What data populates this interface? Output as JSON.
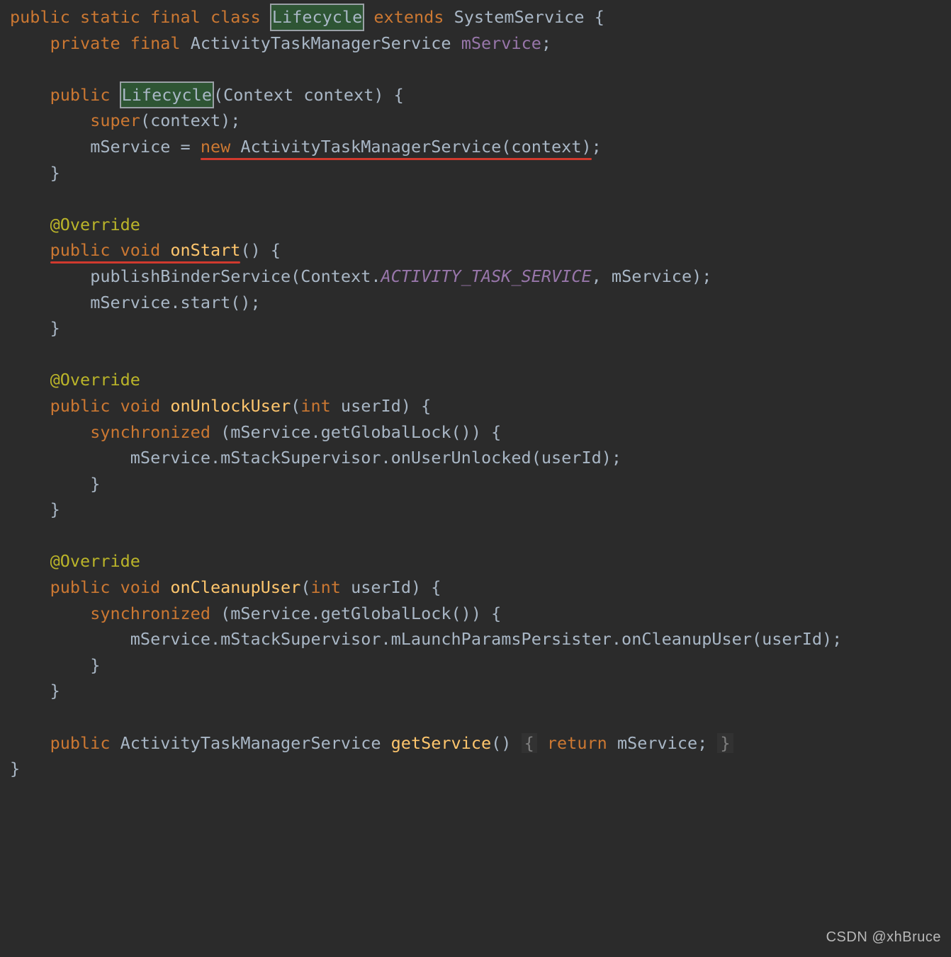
{
  "code": {
    "l1": {
      "kw_public": "public",
      "kw_static": "static",
      "kw_final": "final",
      "kw_class": "class",
      "name": "Lifecycle",
      "kw_extends": "extends",
      "super": "SystemService",
      "brace": "{"
    },
    "l2": {
      "kw_private": "private",
      "kw_final": "final",
      "type": "ActivityTaskManagerService",
      "field": "mService",
      "semi": ";"
    },
    "l3": {
      "kw_public": "public",
      "name": "Lifecycle",
      "params": "(Context context) {"
    },
    "l4": {
      "kw_super": "super",
      "rest": "(context);"
    },
    "l5": {
      "lhs": "mService = ",
      "kw_new": "new",
      "call": " ActivityTaskManagerService(context)",
      "semi": ";"
    },
    "l6": {
      "brace": "}"
    },
    "l7": {
      "ann": "@Override"
    },
    "l8": {
      "kw_public": "public",
      "kw_void": "void",
      "name": "onStart",
      "rest": "() {"
    },
    "l9": {
      "call": "publishBinderService(Context.",
      "field": "ACTIVITY_TASK_SERVICE",
      "rest": ", mService);"
    },
    "l10": {
      "call": "mService.start();"
    },
    "l11": {
      "brace": "}"
    },
    "l12": {
      "ann": "@Override"
    },
    "l13": {
      "kw_public": "public",
      "kw_void": "void",
      "name": "onUnlockUser",
      "paren": "(",
      "kw_int": "int",
      "rest": " userId) {"
    },
    "l14": {
      "kw_sync": "synchronized",
      "rest": " (mService.getGlobalLock()) {"
    },
    "l15": {
      "call": "mService.mStackSupervisor.onUserUnlocked(userId);"
    },
    "l16": {
      "brace": "}"
    },
    "l17": {
      "brace": "}"
    },
    "l18": {
      "ann": "@Override"
    },
    "l19": {
      "kw_public": "public",
      "kw_void": "void",
      "name": "onCleanupUser",
      "paren": "(",
      "kw_int": "int",
      "rest": " userId) {"
    },
    "l20": {
      "kw_sync": "synchronized",
      "rest": " (mService.getGlobalLock()) {"
    },
    "l21": {
      "call": "mService.mStackSupervisor.mLaunchParamsPersister.onCleanupUser(userId);"
    },
    "l22": {
      "brace": "}"
    },
    "l23": {
      "brace": "}"
    },
    "l24": {
      "kw_public": "public",
      "type": "ActivityTaskManagerService",
      "name": "getService",
      "rest": "() ",
      "b1": "{",
      "kw_return": " return ",
      "expr": "mService; ",
      "b2": "}"
    },
    "l25": {
      "brace": "}"
    }
  },
  "watermark": "CSDN @xhBruce"
}
